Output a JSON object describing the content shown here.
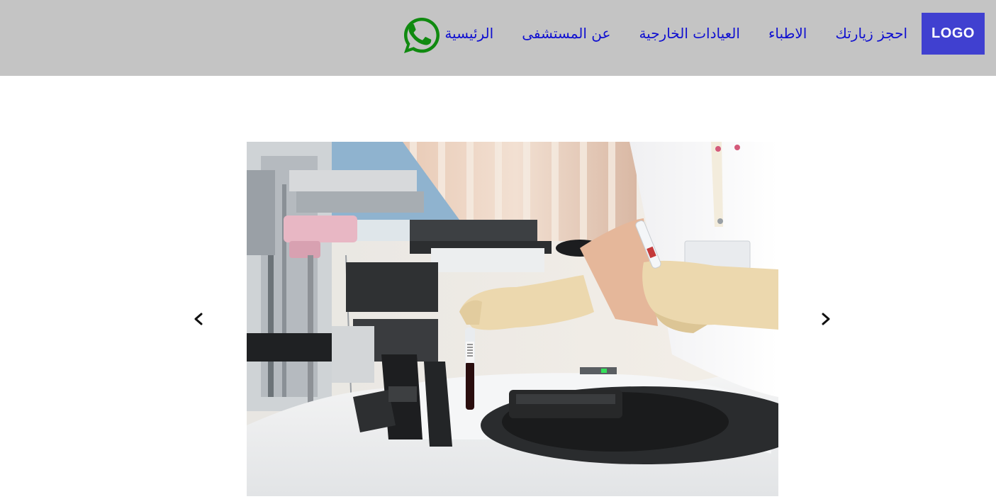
{
  "header": {
    "logo_text": "LOGO",
    "logo_color": "#4040d0",
    "background_color": "#c4c4c4",
    "nav_items": [
      {
        "label": "الرئيسية"
      },
      {
        "label": "عن المستشفى"
      },
      {
        "label": "العيادات الخارجية"
      },
      {
        "label": "الاطباء"
      },
      {
        "label": "احجز زيارتك"
      }
    ],
    "nav_link_color": "#1010d0",
    "whatsapp_icon": "whatsapp-icon",
    "whatsapp_color": "#108a10"
  },
  "carousel": {
    "image_subject": "laboratory technician with gloved hands placing blood sample tube into analyzer",
    "prev_icon": "chevron-left-icon",
    "next_icon": "chevron-right-icon"
  }
}
